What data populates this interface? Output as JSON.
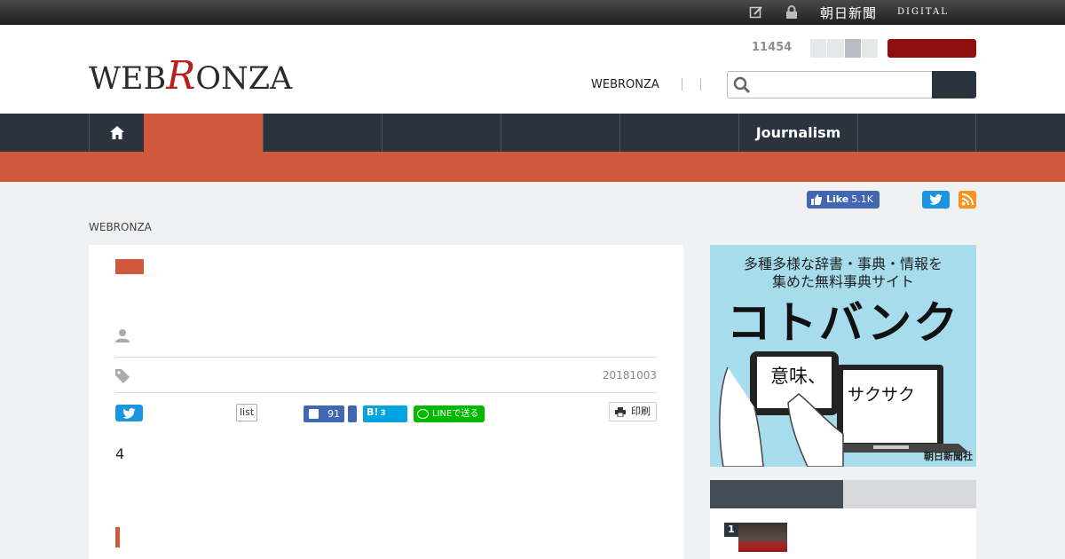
{
  "topbar": {
    "brand": "朝日新聞",
    "brand_sub": "DIGITAL",
    "icons": [
      "edit-icon",
      "lock-icon"
    ]
  },
  "header": {
    "logo_prefix": "WEB",
    "logo_r": "R",
    "logo_suffix": "ONZA",
    "count": "11454",
    "link": "WEBRONZA",
    "search_placeholder": ""
  },
  "nav": {
    "items": [
      "",
      "",
      "",
      "",
      "Journalism",
      ""
    ]
  },
  "social_top": {
    "fb_like": "Like",
    "fb_count": "5.1K"
  },
  "breadcrumb": "WEBRONZA",
  "article": {
    "date": "20181003",
    "list_label": "list",
    "fb_count": "91",
    "hatena_label": "B!",
    "hatena_count": "3",
    "line_label": "LINEで送る",
    "print_label": "印刷",
    "body_first": "4"
  },
  "ad": {
    "line1": "多種多様な辞書・事典・情報を",
    "line2": "集めた無料事典サイト",
    "title": "コトバンク",
    "bubble1": "意味、",
    "bubble2": "サクサク",
    "footer": "朝日新聞社"
  },
  "ranking": {
    "first_rank": "1"
  },
  "colors": {
    "accent": "#d0583c",
    "nav": "#2b343c",
    "brand_red": "#8e0f0f",
    "twitter": "#1b95e0",
    "facebook": "#4267b2",
    "line": "#00b900",
    "hatena": "#00a4de",
    "ad_bg": "#a6dcec"
  }
}
